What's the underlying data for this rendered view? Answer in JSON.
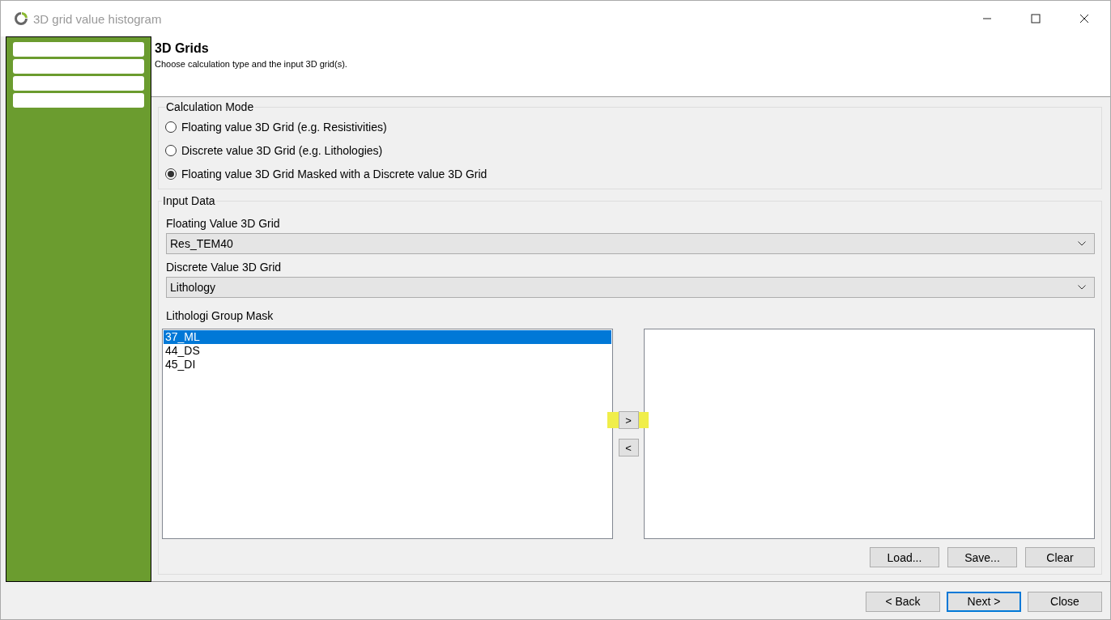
{
  "window": {
    "title": "3D grid value histogram"
  },
  "sidebar": {
    "items": [
      {
        "selected": false
      },
      {
        "selected": false
      },
      {
        "selected": false
      },
      {
        "selected": false
      }
    ]
  },
  "header": {
    "title": "3D Grids",
    "subtitle": "Choose calculation type and the input 3D grid(s)."
  },
  "calculation_mode": {
    "legend": "Calculation Mode",
    "options": [
      {
        "label": "Floating value 3D Grid (e.g. Resistivities)",
        "selected": false
      },
      {
        "label": "Discrete value 3D Grid (e.g. Lithologies)",
        "selected": false
      },
      {
        "label": "Floating value 3D Grid Masked with a Discrete value 3D Grid",
        "selected": true
      }
    ]
  },
  "input_data": {
    "legend": "Input Data",
    "floating_grid": {
      "label": "Floating Value 3D Grid",
      "value": "Res_TEM40"
    },
    "discrete_grid": {
      "label": "Discrete Value 3D Grid",
      "value": "Lithology"
    },
    "mask": {
      "label": "Lithologi Group Mask",
      "available": [
        {
          "label": "37_ML",
          "selected": true
        },
        {
          "label": "44_DS",
          "selected": false
        },
        {
          "label": "45_DI",
          "selected": false
        }
      ],
      "add_button": ">",
      "remove_button": "<"
    },
    "buttons": [
      "Load...",
      "Save...",
      "Clear"
    ]
  },
  "footer": {
    "buttons": [
      {
        "label": "< Back",
        "default": false
      },
      {
        "label": "Next >",
        "default": true
      },
      {
        "label": "Close",
        "default": false
      }
    ]
  }
}
